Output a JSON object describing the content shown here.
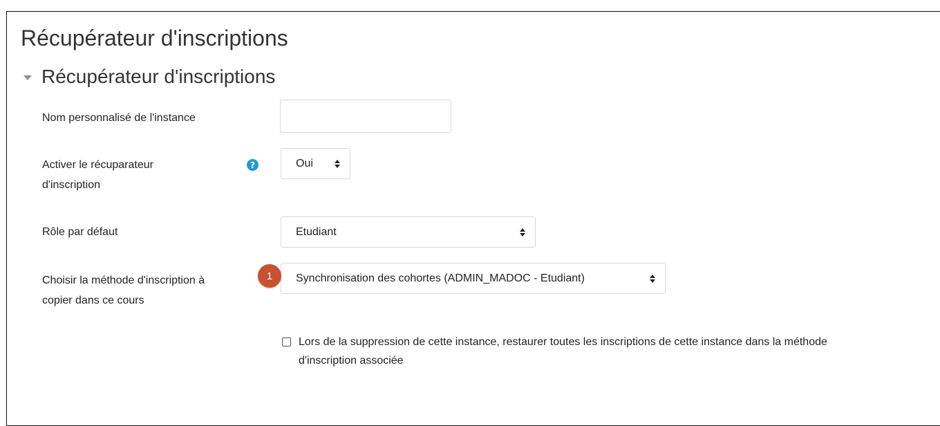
{
  "page": {
    "title": "Récupérateur d'inscriptions"
  },
  "section": {
    "title": "Récupérateur d'inscriptions",
    "expanded": true
  },
  "fields": {
    "instance_name": {
      "label": "Nom personnalisé de l'instance",
      "value": ""
    },
    "activate": {
      "label_line1": "Activer le récuparateur",
      "label_line2": "d'inscription",
      "value": "Oui",
      "help_icon": "?"
    },
    "default_role": {
      "label": "Rôle par défaut",
      "value": "Etudiant"
    },
    "method": {
      "label_line1": "Choisir la méthode d'inscription à",
      "label_line2": "copier dans ce cours",
      "value": "Synchronisation des cohortes (ADMIN_MADOC - Etudiant)",
      "badge": "1"
    },
    "restore": {
      "checked": false,
      "label_line1": "Lors de la suppression de cette instance, restaurer toutes les inscriptions de cette instance dans la méthode",
      "label_line2": "d'inscription associée"
    }
  },
  "colors": {
    "help_icon": "#1f9ad6",
    "badge": "#c8512f",
    "border": "#d5d9dc"
  }
}
